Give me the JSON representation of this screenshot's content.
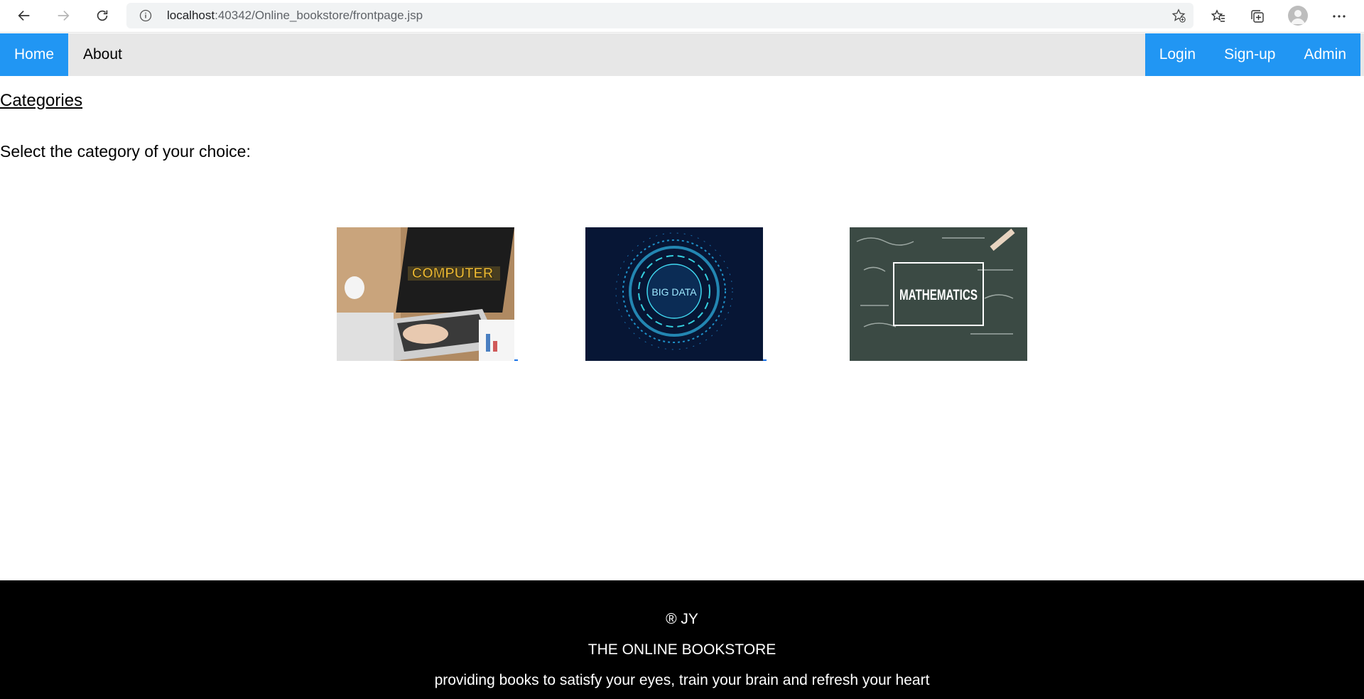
{
  "browser": {
    "url_host": "localhost",
    "url_path": ":40342/Online_bookstore/frontpage.jsp"
  },
  "navbar": {
    "left": [
      {
        "label": "Home"
      },
      {
        "label": "About"
      }
    ],
    "right": [
      {
        "label": "Login"
      },
      {
        "label": "Sign-up"
      },
      {
        "label": "Admin"
      }
    ]
  },
  "main": {
    "categories_link": "Categories",
    "instruction": "Select the category of your choice:",
    "categories": [
      {
        "label": "COMPUTER"
      },
      {
        "label": "BIG DATA"
      },
      {
        "label": "MATHEMATICS"
      }
    ]
  },
  "footer": {
    "copyright": "® JY",
    "title": "THE ONLINE BOOKSTORE",
    "tagline": "providing books to satisfy your eyes, train your brain and refresh your heart"
  },
  "colors": {
    "accent": "#2196f3",
    "navbar_bg": "#e7e7e7",
    "footer_bg": "#000000"
  }
}
